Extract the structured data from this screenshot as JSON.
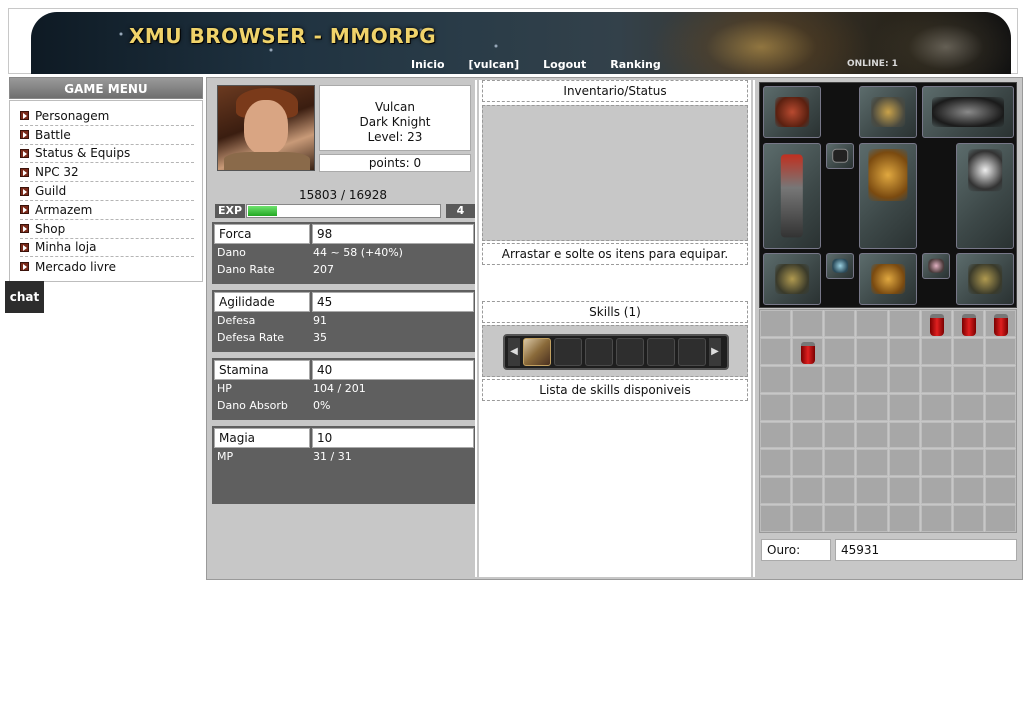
{
  "header": {
    "title": "XMU BROWSER - MMORPG",
    "nav": [
      "Inicio",
      "[vulcan]",
      "Logout",
      "Ranking"
    ],
    "online": "ONLINE: 1"
  },
  "menu": {
    "title": "GAME MENU",
    "items": [
      "Personagem",
      "Battle",
      "Status & Equips",
      "NPC 32",
      "Guild",
      "Armazem",
      "Shop",
      "Minha loja",
      "Mercado livre"
    ]
  },
  "chat": {
    "label": "chat"
  },
  "character": {
    "name": "Vulcan",
    "class": "Dark Knight",
    "level": "Level: 23",
    "points": "points: 0",
    "exp_text": "15803 / 16928",
    "exp_label": "EXP",
    "exp_fraction": 0.15,
    "exp_level_badge": "4"
  },
  "stats": [
    {
      "name": "Forca",
      "value": "98",
      "rows": [
        {
          "k": "Dano",
          "v": "44 ~ 58 (+40%)"
        },
        {
          "k": "Dano Rate",
          "v": "207"
        }
      ]
    },
    {
      "name": "Agilidade",
      "value": "45",
      "rows": [
        {
          "k": "Defesa",
          "v": "91"
        },
        {
          "k": "Defesa Rate",
          "v": "35"
        }
      ]
    },
    {
      "name": "Stamina",
      "value": "40",
      "rows": [
        {
          "k": "HP",
          "v": "104 / 201"
        },
        {
          "k": "Dano Absorb",
          "v": "0%"
        }
      ]
    },
    {
      "name": "Magia",
      "value": "10",
      "rows": [
        {
          "k": "MP",
          "v": "31 / 31"
        }
      ]
    }
  ],
  "middle": {
    "inventory_title": "Inventario/Status",
    "drag_hint": "Arrastar e solte os itens para equipar.",
    "skills_title": "Skills (1)",
    "skills_hint": "Lista de skills disponiveis"
  },
  "equip_slots": [
    "wings-pet",
    "helm",
    "wings",
    "weapon",
    "pendant",
    "armor",
    "shield",
    "gloves",
    "ring-left",
    "pants",
    "ring-right",
    "boots"
  ],
  "inventory": {
    "potions": [
      {
        "row": 0,
        "col": 5
      },
      {
        "row": 0,
        "col": 6
      },
      {
        "row": 0,
        "col": 7
      },
      {
        "row": 1,
        "col": 1
      }
    ]
  },
  "gold": {
    "label": "Ouro:",
    "value": "45931"
  }
}
